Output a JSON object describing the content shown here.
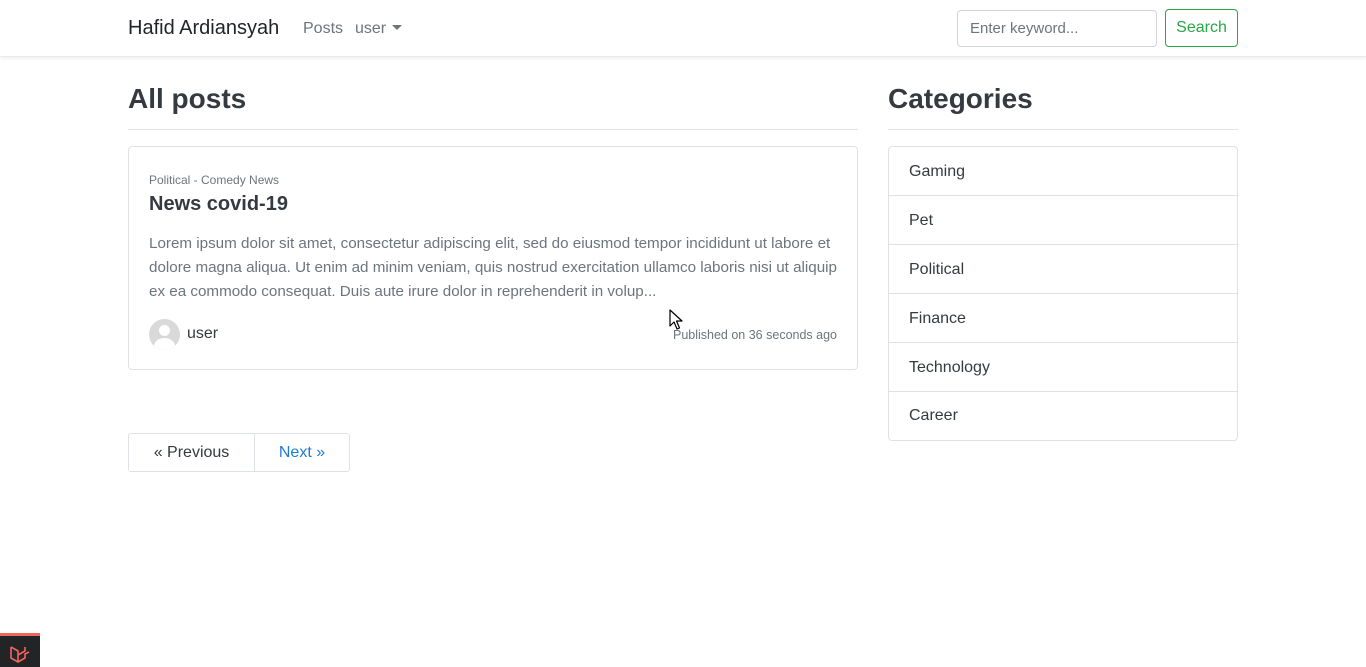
{
  "navbar": {
    "brand": "Hafid Ardiansyah",
    "posts_link": "Posts",
    "user_menu": "user",
    "search_placeholder": "Enter keyword...",
    "search_button": "Search"
  },
  "main": {
    "heading": "All posts",
    "posts": [
      {
        "category": "Political - Comedy News",
        "title": "News covid-19",
        "excerpt": "Lorem ipsum dolor sit amet, consectetur adipiscing elit, sed do eiusmod tempor incididunt ut labore et dolore magna aliqua. Ut enim ad minim veniam, quis nostrud exercitation ullamco laboris nisi ut aliquip ex ea commodo consequat. Duis aute irure dolor in reprehenderit in volup...",
        "author": "user",
        "published": "Published on 36 seconds ago"
      }
    ],
    "pagination": {
      "previous": "« Previous",
      "next": "Next »"
    }
  },
  "sidebar": {
    "heading": "Categories",
    "categories": [
      "Gaming",
      "Pet",
      "Political",
      "Finance",
      "Technology",
      "Career"
    ]
  },
  "colors": {
    "success": "#28a745",
    "link": "#1e7bd5",
    "debug_accent": "#f4645f"
  }
}
